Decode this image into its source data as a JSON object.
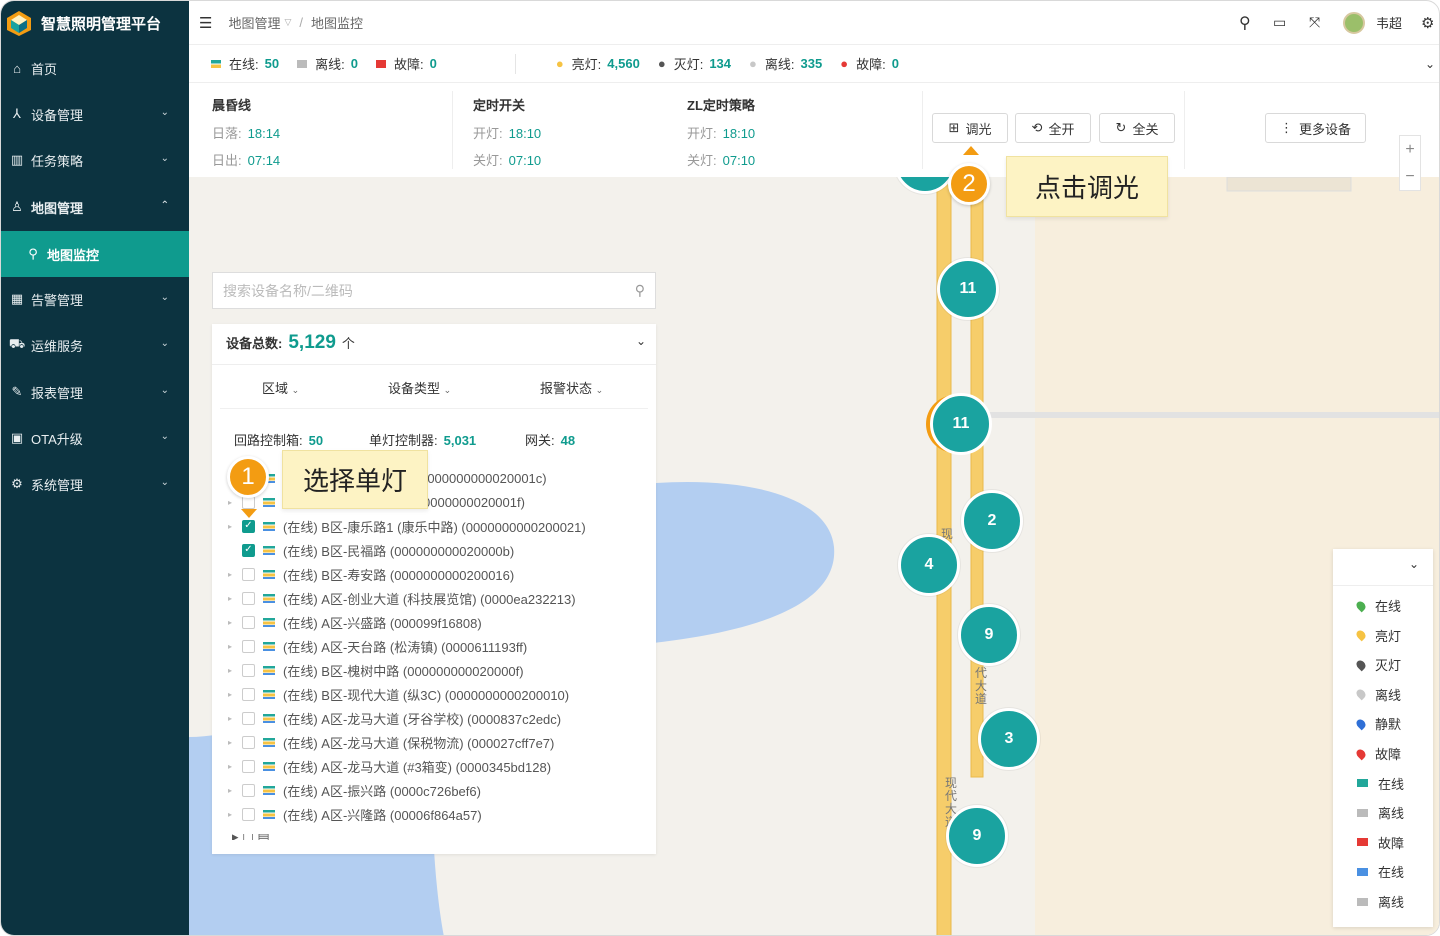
{
  "app": {
    "title": "智慧照明管理平台"
  },
  "sidebar": {
    "items": [
      {
        "label": "首页",
        "icon": "home-icon"
      },
      {
        "label": "设备管理",
        "icon": "device-icon"
      },
      {
        "label": "任务策略",
        "icon": "task-icon"
      },
      {
        "label": "地图管理",
        "icon": "user-map-icon"
      },
      {
        "label": "地图监控",
        "icon": "location-pin-icon"
      },
      {
        "label": "告警管理",
        "icon": "alarm-grid-icon"
      },
      {
        "label": "运维服务",
        "icon": "truck-icon"
      },
      {
        "label": "报表管理",
        "icon": "report-icon"
      },
      {
        "label": "OTA升级",
        "icon": "ota-icon"
      },
      {
        "label": "系统管理",
        "icon": "gear-icon"
      }
    ]
  },
  "header": {
    "breadcrumb1": "地图管理",
    "breadcrumb_sep": "/",
    "breadcrumb2": "地图监控",
    "user": "韦超"
  },
  "status": {
    "online_label": "在线:",
    "online": "50",
    "offline_label": "离线:",
    "offline": "0",
    "fault_label": "故障:",
    "fault": "0",
    "light_on_label": "亮灯:",
    "light_on": "4,560",
    "light_off_label": "灭灯:",
    "light_off": "134",
    "lamp_offline_label": "离线:",
    "lamp_offline": "335",
    "lamp_fault_label": "故障:",
    "lamp_fault": "0"
  },
  "strategy": {
    "s1": {
      "title": "晨昏线",
      "r1": "日落:",
      "v1": "18:14",
      "r2": "日出:",
      "v2": "07:14"
    },
    "s2": {
      "title": "定时开关",
      "r1": "开灯:",
      "v1": "18:10",
      "r2": "关灯:",
      "v2": "07:10"
    },
    "s3": {
      "title": "ZL定时策略",
      "r1": "开灯:",
      "v1": "18:10",
      "r2": "关灯:",
      "v2": "07:10"
    },
    "btn_dim": "调光",
    "btn_all_on": "全开",
    "btn_all_off": "全关",
    "btn_more": "更多设备"
  },
  "search": {
    "placeholder": "搜索设备名称/二维码"
  },
  "panel": {
    "total_label": "设备总数:",
    "total": "5,129",
    "total_unit": "个",
    "filter_area": "区域",
    "filter_type": "设备类型",
    "filter_alarm": "报警状态",
    "c1_label": "回路控制箱:",
    "c1": "50",
    "c2_label": "单灯控制器:",
    "c2": "5,031",
    "c3_label": "网关:",
    "c3": "48",
    "devices": [
      {
        "text": "(000000000020001c)",
        "checked": false
      },
      {
        "text": "0000000020001f)",
        "checked": false
      },
      {
        "text": "(在线) B区-康乐路1 (康乐中路)  (0000000000200021)",
        "checked": true
      },
      {
        "text": "(在线) B区-民福路  (000000000020000b)",
        "checked": true
      },
      {
        "text": "(在线) B区-寿安路  (0000000000200016)",
        "checked": false
      },
      {
        "text": "(在线) A区-创业大道 (科技展览馆)  (0000ea232213)",
        "checked": false
      },
      {
        "text": "(在线) A区-兴盛路  (000099f16808)",
        "checked": false
      },
      {
        "text": "(在线) A区-天台路 (松涛镇)  (0000611193ff)",
        "checked": false
      },
      {
        "text": "(在线) B区-槐树中路  (000000000020000f)",
        "checked": false
      },
      {
        "text": "(在线) B区-现代大道 (纵3C)  (0000000000200010)",
        "checked": false
      },
      {
        "text": "(在线) A区-龙马大道 (牙谷学校)  (0000837c2edc)",
        "checked": false
      },
      {
        "text": "(在线) A区-龙马大道 (保税物流)  (000027cff7e7)",
        "checked": false
      },
      {
        "text": "(在线) A区-龙马大道 (#3箱变)  (0000345bd128)",
        "checked": false
      },
      {
        "text": "(在线) A区-振兴路  (0000c726bef6)",
        "checked": false
      },
      {
        "text": "(在线) A区-兴隆路  (00006f864a57)",
        "checked": false
      }
    ]
  },
  "map": {
    "clusters": [
      "11",
      "11",
      "2",
      "4",
      "9",
      "3",
      "9"
    ],
    "road_label1": "现",
    "road_label2": "代大道",
    "road_label3": "现代大道"
  },
  "legend": {
    "items": [
      {
        "label": "在线",
        "color": "#4caf50"
      },
      {
        "label": "亮灯",
        "color": "#f6c343"
      },
      {
        "label": "灭灯",
        "color": "#555555"
      },
      {
        "label": "离线",
        "color": "#c8c8c8"
      },
      {
        "label": "静默",
        "color": "#2f6fd6"
      },
      {
        "label": "故障",
        "color": "#e53935"
      },
      {
        "label": "在线",
        "color": "#22a79a"
      },
      {
        "label": "离线",
        "color": "#bbbbbb"
      },
      {
        "label": "故障",
        "color": "#e53935"
      },
      {
        "label": "在线",
        "color": "#4a90e2"
      },
      {
        "label": "离线",
        "color": "#bbbbbb"
      }
    ]
  },
  "callouts": {
    "n1": "1",
    "t1": "选择单灯",
    "n2": "2",
    "t2": "点击调光"
  },
  "colors": {
    "sidebar": "#0c3340",
    "accent": "#0f9b8e",
    "cluster": "#1aa3a0",
    "callout": "#f39c12"
  }
}
